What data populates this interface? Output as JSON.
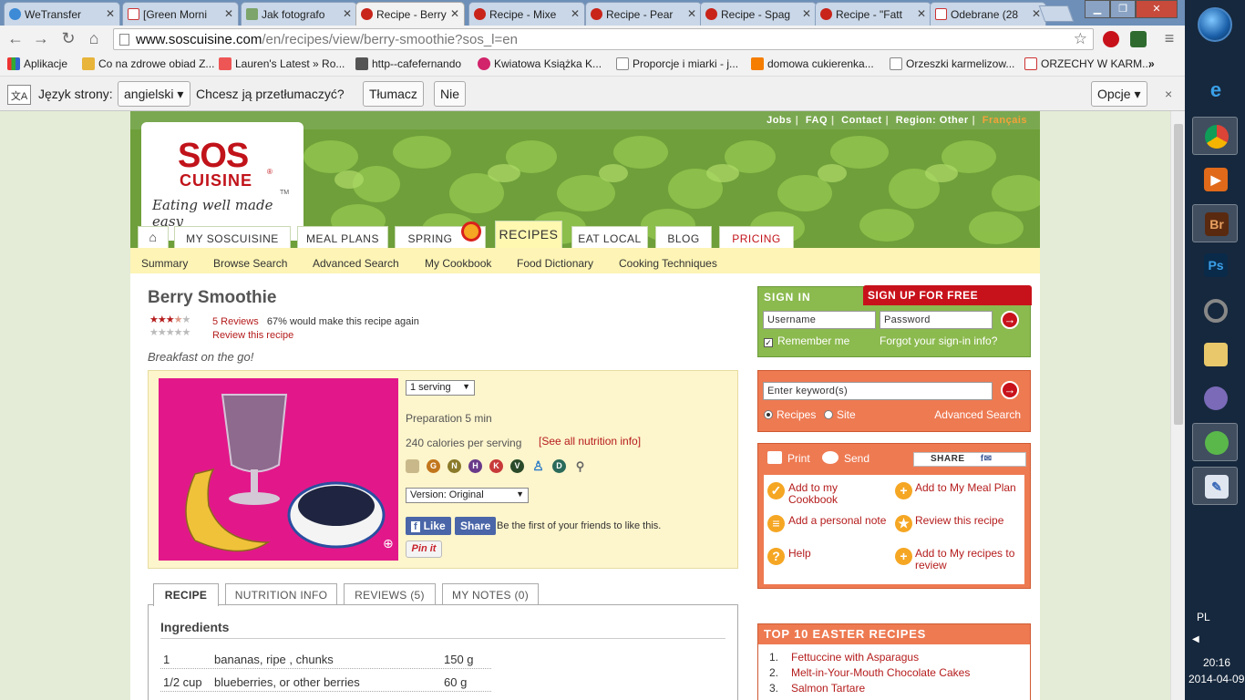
{
  "browser": {
    "tabs": [
      {
        "label": "WeTransfer",
        "icon": "wetransfer-icon"
      },
      {
        "label": "[Green Morni",
        "icon": "gmail-icon"
      },
      {
        "label": "Jak fotografo",
        "icon": "image-icon"
      },
      {
        "label": "Recipe - Berry",
        "icon": "tomato-icon",
        "active": true
      },
      {
        "label": "Recipe - Mixe",
        "icon": "tomato-icon"
      },
      {
        "label": "Recipe - Pear",
        "icon": "tomato-icon"
      },
      {
        "label": "Recipe - Spag",
        "icon": "tomato-icon"
      },
      {
        "label": "Recipe - \"Fatt",
        "icon": "tomato-icon"
      },
      {
        "label": "Odebrane (28",
        "icon": "gmail-icon"
      }
    ],
    "url_domain": "www.soscuisine.com",
    "url_path": "/en/recipes/view/berry-smoothie?sos_l=en",
    "bookmarks": [
      "Aplikacje",
      "Co na zdrowe obiad Z...",
      "Lauren's Latest » Ro...",
      "http--cafefernando",
      "Kwiatowa Książka K...",
      "Proporcje i miarki - j...",
      "domowa cukierenka...",
      "Orzeszki karmelizow...",
      "ORZECHY W KARM..."
    ],
    "bookmarks_more": "»",
    "translate": {
      "page_language_label": "Język strony:",
      "language": "angielski",
      "question": "Chcesz ją przetłumaczyć?",
      "translate_btn": "Tłumacz",
      "no_btn": "Nie",
      "options_btn": "Opcje",
      "close": "×"
    }
  },
  "taskbar": {
    "lang": "PL",
    "time": "20:16",
    "date": "2014-04-09"
  },
  "site": {
    "top_links": [
      "Jobs",
      "FAQ",
      "Contact",
      "Region: Other"
    ],
    "top_link_fr": "Français",
    "logo": {
      "sos": "SOS",
      "cuisine": "CUISINE",
      "tagline": "Eating well made easy",
      "tm": "TM",
      "reg": "®"
    },
    "nav": [
      "MY SOSCUISINE",
      "MEAL PLANS",
      "SPRING",
      "RECIPES",
      "EAT LOCAL",
      "BLOG",
      "PRICING"
    ],
    "subnav": [
      "Summary",
      "Browse Search",
      "Advanced Search",
      "My Cookbook",
      "Food Dictionary",
      "Cooking Techniques"
    ]
  },
  "recipe": {
    "title": "Berry Smoothie",
    "rating": 3.5,
    "reviews_link": "5 Reviews",
    "make_again": "67% would make this recipe again",
    "review_this": "Review this recipe",
    "tagline": "Breakfast on the go!",
    "servings": "1 serving",
    "preparation": "Preparation 5 min",
    "calories": "240 calories per serving",
    "nutrition_link": "[See all nutrition info]",
    "diet_icons": [
      "G",
      "N",
      "H",
      "K",
      "V",
      "D"
    ],
    "version": "Version: Original",
    "fb_like": "Like",
    "fb_share": "Share",
    "fb_text": "Be the first of your friends to like this.",
    "pinit": "Pin it",
    "content_tabs": [
      "RECIPE",
      "NUTRITION INFO",
      "REVIEWS (5)",
      "MY NOTES (0)"
    ],
    "ingredients_heading": "Ingredients",
    "ingredients": [
      {
        "qty": "1",
        "name": "bananas, ripe , chunks",
        "amount": "150 g"
      },
      {
        "qty": "1/2 cup",
        "name": "blueberries, or other berries",
        "amount": "60 g"
      }
    ]
  },
  "signin": {
    "tab_signin": "SIGN IN",
    "tab_signup": "SIGN UP FOR FREE",
    "username_ph": "Username",
    "password_ph": "Password",
    "remember": "Remember me",
    "forgot": "Forgot your sign-in info?"
  },
  "search": {
    "placeholder": "Enter keyword(s)",
    "opt_recipes": "Recipes",
    "opt_site": "Site",
    "advanced": "Advanced Search"
  },
  "actions": {
    "print": "Print",
    "send": "Send",
    "share": "SHARE",
    "add_cookbook": "Add to my Cookbook",
    "add_meal_plan": "Add to My Meal Plan",
    "add_note": "Add a personal note",
    "review": "Review this recipe",
    "help": "Help",
    "add_to_review": "Add to My recipes to review"
  },
  "top10": {
    "heading": "TOP 10 EASTER RECIPES",
    "items": [
      "Fettuccine with Asparagus",
      "Melt-in-Your-Mouth Chocolate Cakes",
      "Salmon Tartare"
    ]
  },
  "colors": {
    "brand_red": "#c1131a",
    "green": "#7aa850",
    "orange": "#ee7a52",
    "cream": "#fdf5cc"
  }
}
